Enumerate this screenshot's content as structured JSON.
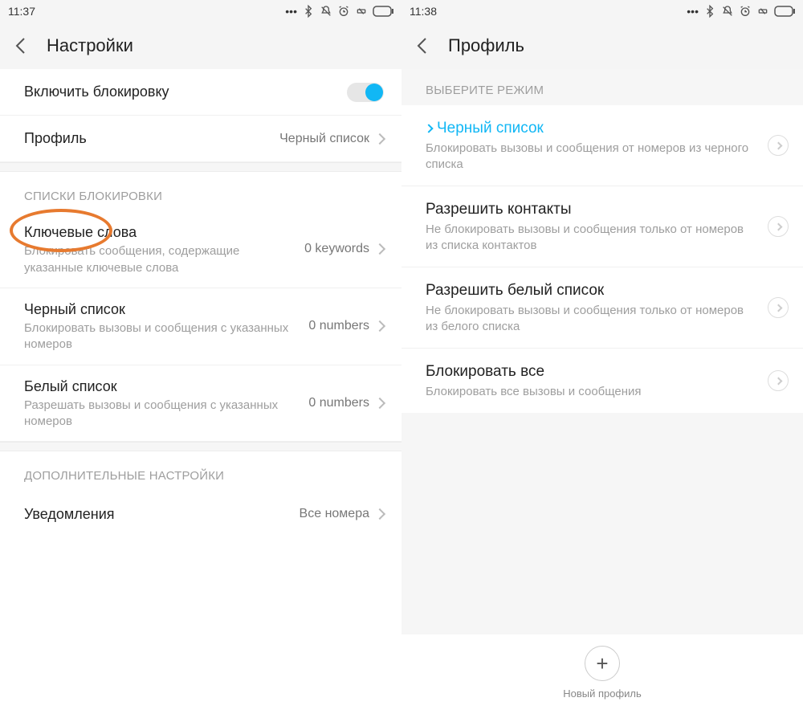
{
  "left": {
    "time": "11:37",
    "status_icons": [
      "dots-icon",
      "bluetooth-icon",
      "mute-icon",
      "alarm-icon",
      "dnd-icon",
      "battery-icon"
    ],
    "header_title": "Настройки",
    "enable_block": {
      "label": "Включить блокировку",
      "on": true
    },
    "profile": {
      "label": "Профиль",
      "value": "Черный список"
    },
    "section_lists": "СПИСКИ БЛОКИРОВКИ",
    "keywords": {
      "title": "Ключевые слова",
      "sub": "Блокировать сообщения, содержащие указанные ключевые слова",
      "value": "0 keywords"
    },
    "blacklist": {
      "title": "Черный список",
      "sub": "Блокировать вызовы и сообщения с указанных номеров",
      "value": "0 numbers"
    },
    "whitelist": {
      "title": "Белый список",
      "sub": "Разрешать вызовы и сообщения с указанных номеров",
      "value": "0 numbers"
    },
    "section_extra": "ДОПОЛНИТЕЛЬНЫЕ НАСТРОЙКИ",
    "notifications": {
      "title": "Уведомления",
      "value": "Все номера"
    }
  },
  "right": {
    "time": "11:38",
    "status_icons": [
      "dots-icon",
      "bluetooth-icon",
      "mute-icon",
      "alarm-icon",
      "dnd-icon",
      "battery-icon"
    ],
    "header_title": "Профиль",
    "section_mode": "ВЫБЕРИТЕ РЕЖИМ",
    "modes": [
      {
        "title": "Черный список",
        "sub": "Блокировать вызовы и сообщения от номеров из черного списка",
        "active": true
      },
      {
        "title": "Разрешить контакты",
        "sub": "Не блокировать вызовы и сообщения только от номеров из списка контактов",
        "active": false
      },
      {
        "title": "Разрешить белый список",
        "sub": "Не блокировать вызовы и сообщения только от номеров из белого списка",
        "active": false
      },
      {
        "title": "Блокировать все",
        "sub": "Блокировать все вызовы и сообщения",
        "active": false
      }
    ],
    "new_profile": "Новый профиль"
  },
  "colors": {
    "accent": "#11b7f5",
    "highlight": "#e77a2f"
  }
}
